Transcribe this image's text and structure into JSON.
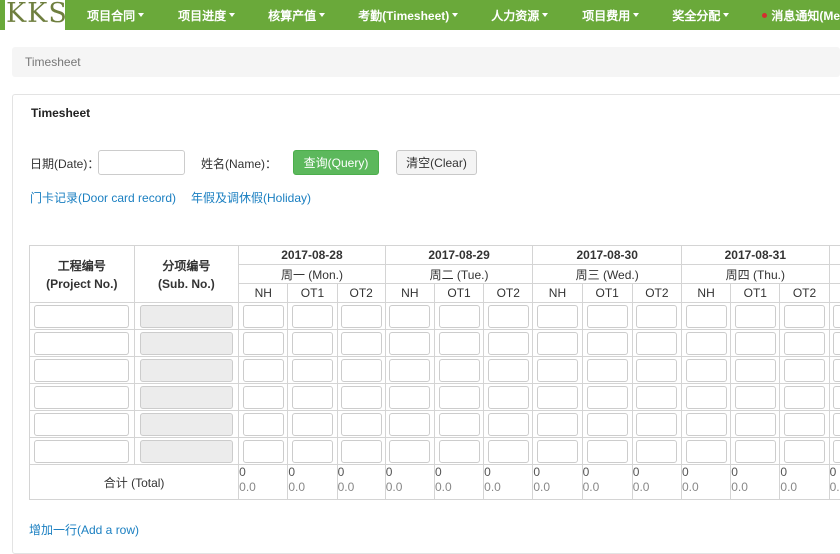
{
  "logo": {
    "text": "KKSIC"
  },
  "nav": {
    "items": [
      {
        "label": "项目合同"
      },
      {
        "label": "项目进度"
      },
      {
        "label": "核算产值"
      },
      {
        "label": "考勤(Timesheet)"
      },
      {
        "label": "人力资源"
      },
      {
        "label": "项目费用"
      },
      {
        "label": "奖全分配"
      }
    ],
    "notice_label": "消息通知(Me"
  },
  "breadcrumb": {
    "text": "Timesheet"
  },
  "panel": {
    "title": "Timesheet"
  },
  "form": {
    "date_label": "日期(Date)：",
    "name_label": "姓名(Name)：",
    "query_button": "查询(Query)",
    "clear_button": "清空(Clear)",
    "door_card_link": "门卡记录(Door card record)",
    "holiday_link": "年假及调休假(Holiday)"
  },
  "table": {
    "project_header": [
      "工程编号",
      "(Project No.)"
    ],
    "sub_header": [
      "分项编号",
      "(Sub. No.)"
    ],
    "days": [
      {
        "date": "2017-08-28",
        "weekday": "周一 (Mon.)"
      },
      {
        "date": "2017-08-29",
        "weekday": "周二 (Tue.)"
      },
      {
        "date": "2017-08-30",
        "weekday": "周三 (Wed.)"
      },
      {
        "date": "2017-08-31",
        "weekday": "周四 (Thu.)"
      }
    ],
    "cols": [
      "NH",
      "OT1",
      "OT2"
    ],
    "extra_col": "NH",
    "row_count": 6,
    "total_label": "合计 (Total)",
    "total_values": [
      "0",
      "0.0"
    ]
  },
  "add_row_link": "增加一行(Add a row)"
}
